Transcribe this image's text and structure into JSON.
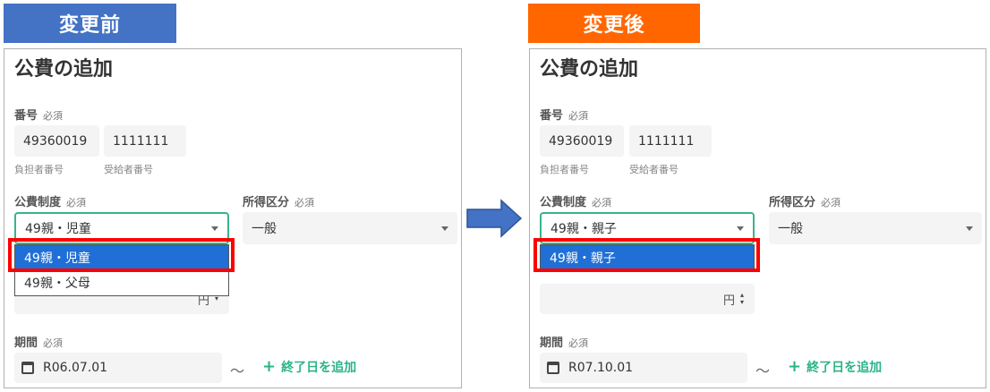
{
  "labels": {
    "before": "変更前",
    "after": "変更後"
  },
  "form": {
    "title": "公費の追加",
    "number_label": "番号",
    "required": "必須",
    "system_label": "公費制度",
    "income_label": "所得区分",
    "period_label": "期間",
    "burden_caption": "負担者番号",
    "recipient_caption": "受給者番号",
    "yen": "円",
    "tilde": "〜",
    "add_end_date": "終了日を追加"
  },
  "before": {
    "burden_no": "49360019",
    "recipient_no": "1111111",
    "system_value": "49親・児童",
    "income_value": "一般",
    "options": [
      "49親・児童",
      "49親・父母"
    ],
    "selected_option": "49親・児童",
    "period_start": "R06.07.01"
  },
  "after": {
    "burden_no": "49360019",
    "recipient_no": "1111111",
    "system_value": "49親・親子",
    "income_value": "一般",
    "options": [
      "49親・親子"
    ],
    "selected_option": "49親・親子",
    "period_start": "R07.10.01"
  },
  "colors": {
    "before_tag": "#4472c4",
    "after_tag": "#ff6600",
    "focus_border": "#38b48b",
    "selected_option": "#1f6fd6",
    "highlight": "#ff0000",
    "add_link": "#2bb38a",
    "arrow": "#4472c4"
  },
  "icons": [
    "calendar-icon",
    "plus-icon",
    "chevron-down-icon",
    "right-arrow-icon"
  ]
}
